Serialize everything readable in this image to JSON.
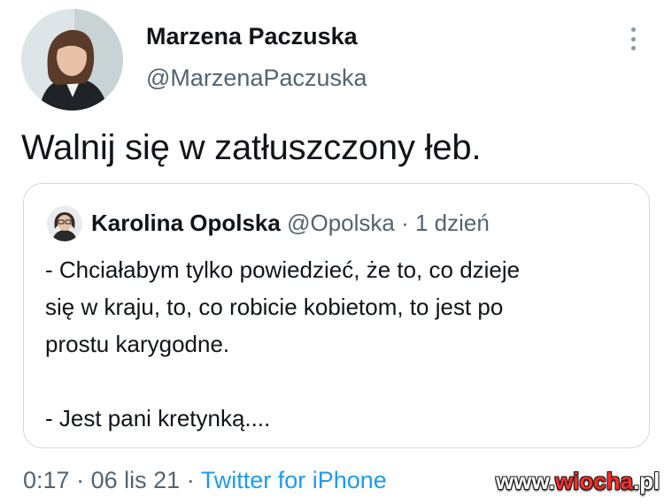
{
  "tweet": {
    "author_name": "Marzena Paczuska",
    "author_handle": "@MarzenaPaczuska",
    "text": "Walnij się w zatłuszczony łeb.",
    "more_icon": "more-vertical-icon"
  },
  "quoted_tweet": {
    "author_name": "Karolina Opolska",
    "author_handle": "@Opolska",
    "separator": "·",
    "time": "1 dzień",
    "lines": [
      "- Chciałabym tylko powiedzieć, że to, co dzieje",
      "się w kraju, to, co robicie kobietom, to jest po",
      "prostu karygodne."
    ],
    "last_line": "- Jest pani kretynką...."
  },
  "footer": {
    "time": "0:17",
    "sep1": "·",
    "date": "06 lis 21",
    "sep2": "·",
    "source": "Twitter for iPhone"
  },
  "watermark": {
    "prefix": "www.",
    "brand": "wiocha",
    "suffix": ".pl"
  },
  "colors": {
    "text": "#0f1419",
    "muted": "#536471",
    "link": "#1d9bf0",
    "border": "#cfd9de",
    "watermark_accent": "#ff2d2d"
  }
}
